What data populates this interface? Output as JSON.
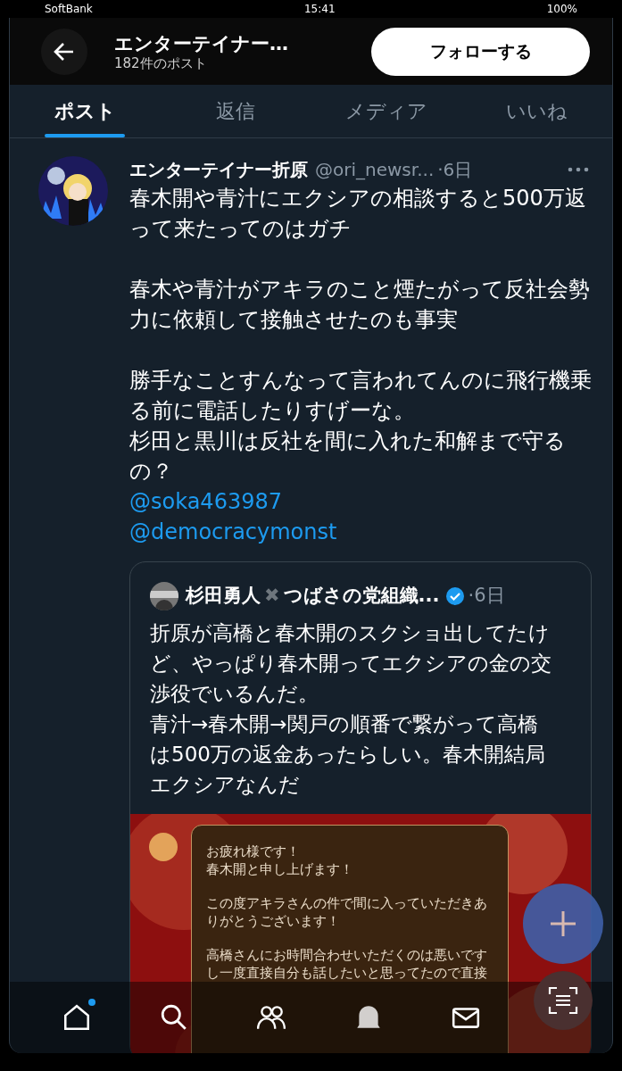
{
  "status_bar": {
    "carrier": "SoftBank",
    "time": "15:41",
    "battery": "100%"
  },
  "header": {
    "title": "エンターテイナー…",
    "subtitle": "182件のポスト",
    "follow_button": "フォローする"
  },
  "tabs": [
    {
      "label": "ポスト",
      "selected": true
    },
    {
      "label": "返信",
      "selected": false
    },
    {
      "label": "メディア",
      "selected": false
    },
    {
      "label": "いいね",
      "selected": false
    }
  ],
  "post": {
    "author": "エンターテイナー折原",
    "handle": "@ori_newsr...",
    "time": "·6日",
    "paragraphs": [
      "春木開や青汁にエクシアの相談すると500万返って来たってのはガチ",
      "春木や青汁がアキラのこと煙たがって反社会勢力に依頼して接触させたのも事実",
      "勝手なことすんなって言われてんのに飛行機乗る前に電話したりすげーな。",
      "杉田と黒川は反社を間に入れた和解まで守るの？"
    ],
    "mentions": [
      "@soka463987",
      "@democracymonst"
    ],
    "quote": {
      "author": "杉田勇人",
      "separator": "✖",
      "author_rest": "つばさの党組織...",
      "verified": true,
      "time": "·6日",
      "lines": [
        "折原が高橋と春木開のスクショ出してたけど、やっぱり春木開ってエクシアの金の交渉役でいるんだ。",
        "青汁→春木開→関戸の順番で繋がって高橋は500万の返金あったらしい。春木開結局エクシアなんだ"
      ],
      "image": {
        "kind": "chat_screenshot",
        "paragraphs": [
          [
            "お疲れ様です！",
            "春木開と申し上げます！"
          ],
          [
            "この度アキラさんの件で間に入っていただきありがとうございます！"
          ],
          [
            "高橋さんにお時間合わせいただくのは悪いですし一度直接自分も話したいと思ってたので直接"
          ]
        ]
      }
    }
  },
  "bottom_nav": [
    {
      "kind": "home",
      "dot": true
    },
    {
      "kind": "search",
      "dot": false
    },
    {
      "kind": "communities",
      "dot": false
    },
    {
      "kind": "notifications",
      "dot": false
    },
    {
      "kind": "messages",
      "dot": false
    }
  ]
}
